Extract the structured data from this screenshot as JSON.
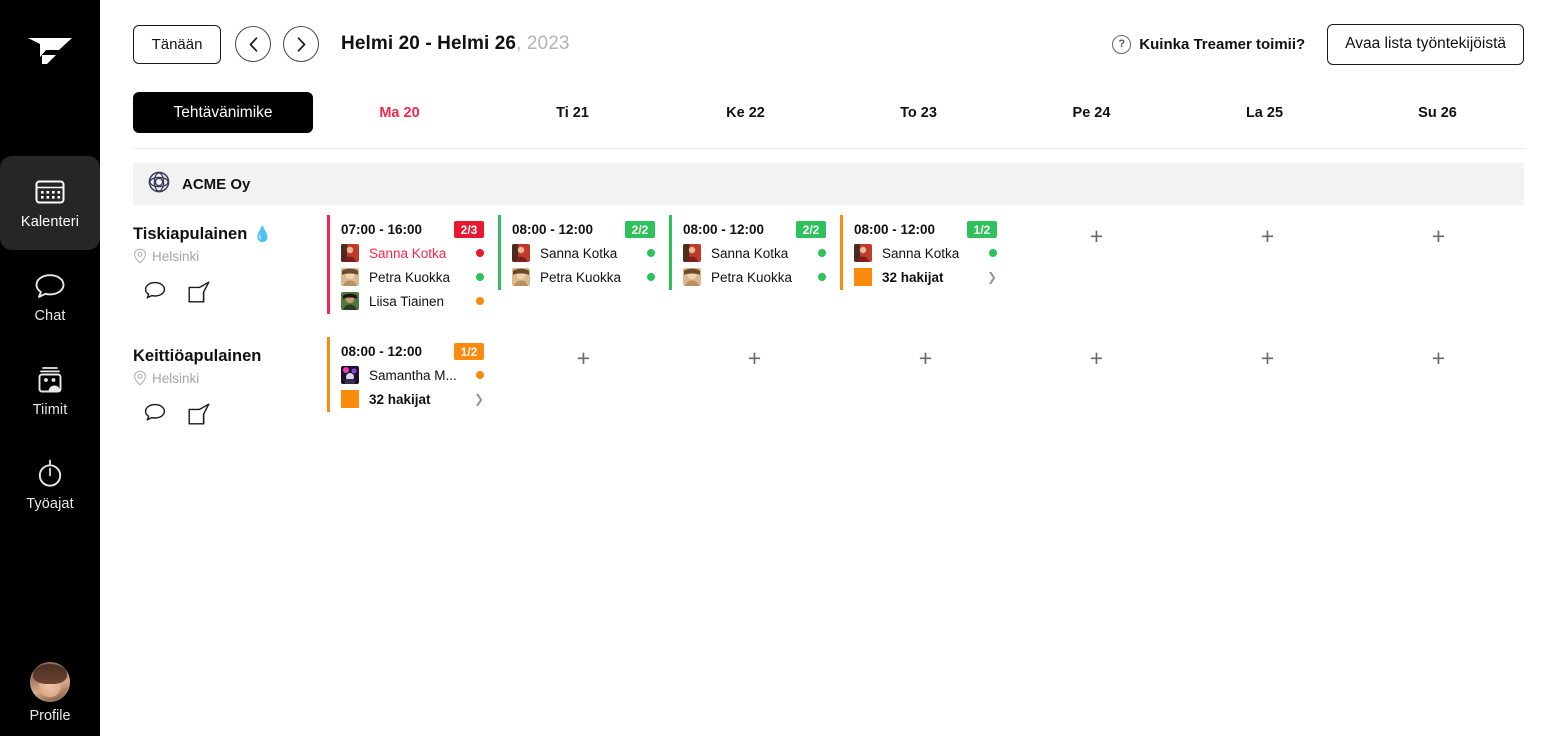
{
  "sidebar": {
    "logo_icon": "treamer-logo-icon",
    "items": [
      {
        "label": "Kalenteri",
        "icon": "calendar-icon",
        "active": true
      },
      {
        "label": "Chat",
        "icon": "chat-bubble-icon",
        "active": false
      },
      {
        "label": "Tiimit",
        "icon": "teams-icon",
        "active": false
      },
      {
        "label": "Työajat",
        "icon": "stopwatch-icon",
        "active": false
      }
    ],
    "profile": {
      "label": "Profile",
      "icon": "avatar-photo"
    }
  },
  "topbar": {
    "today_label": "Tänään",
    "prev_icon": "chevron-left-icon",
    "next_icon": "chevron-right-icon",
    "range_label": "Helmi 20 - Helmi 26",
    "range_separator": ", ",
    "year_label": "2023",
    "help_icon": "question-mark-icon",
    "help_label": "Kuinka Treamer toimii?",
    "open_list_label": "Avaa lista työntekijöistä"
  },
  "header_row": {
    "role_tab_label": "Tehtävänimike",
    "days": [
      {
        "label": "Ma 20",
        "today": true
      },
      {
        "label": "Ti 21",
        "today": false
      },
      {
        "label": "Ke 22",
        "today": false
      },
      {
        "label": "To 23",
        "today": false
      },
      {
        "label": "Pe 24",
        "today": false
      },
      {
        "label": "La 25",
        "today": false
      },
      {
        "label": "Su 26",
        "today": false
      }
    ]
  },
  "company": {
    "name": "ACME Oy",
    "logo_icon": "acme-company-logo-icon"
  },
  "colors": {
    "accent_red": "#f4274a",
    "green": "#2fc15c",
    "orange": "#fc8a0c",
    "black": "#000000",
    "band_gray": "#f2f2f2"
  },
  "location_icon": "map-pin-icon",
  "chat_icon": "chat-bubble-icon",
  "edit_icon": "edit-pencil-icon",
  "plus_icon": "plus-icon",
  "chevron_icon": "chevron-right-icon",
  "rows": [
    {
      "title": "Tiskiapulainen",
      "emoji": "💧",
      "location": "Helsinki",
      "cells": [
        {
          "type": "card",
          "bar_color": "#f4274a",
          "time": "07:00 - 16:00",
          "badge": "2/3",
          "badge_color": "#e8192f",
          "people": [
            {
              "name": "Sanna Kotka",
              "dot": "#e8192f",
              "name_color": "red",
              "avatar": "sanna"
            },
            {
              "name": "Petra Kuokka",
              "dot": "#2fc15c",
              "name_color": "black",
              "avatar": "petra"
            },
            {
              "name": "Liisa Tiainen",
              "dot": "#fc8a0c",
              "name_color": "black",
              "avatar": "liisa"
            }
          ]
        },
        {
          "type": "card",
          "bar_color": "#2fc15c",
          "time": "08:00 - 12:00",
          "badge": "2/2",
          "badge_color": "#2fc15c",
          "people": [
            {
              "name": "Sanna Kotka",
              "dot": "#2fc15c",
              "name_color": "black",
              "avatar": "sanna"
            },
            {
              "name": "Petra Kuokka",
              "dot": "#2fc15c",
              "name_color": "black",
              "avatar": "petra"
            }
          ]
        },
        {
          "type": "card",
          "bar_color": "#2fc15c",
          "time": "08:00 - 12:00",
          "badge": "2/2",
          "badge_color": "#2fc15c",
          "people": [
            {
              "name": "Sanna Kotka",
              "dot": "#2fc15c",
              "name_color": "black",
              "avatar": "sanna"
            },
            {
              "name": "Petra Kuokka",
              "dot": "#2fc15c",
              "name_color": "black",
              "avatar": "petra"
            }
          ]
        },
        {
          "type": "card",
          "bar_color": "#2fc15c",
          "time": "08:00 - 12:00",
          "badge": "1/2",
          "badge_color": "#2fc15c",
          "people": [
            {
              "name": "Sanna Kotka",
              "dot": "#2fc15c",
              "name_color": "black",
              "avatar": "sanna"
            },
            {
              "name": "32 hakijat",
              "chevron": true,
              "name_color": "bold",
              "avatar": "orange-swatch"
            }
          ]
        },
        {
          "type": "empty",
          "plus": "+"
        },
        {
          "type": "empty",
          "plus": "+"
        },
        {
          "type": "empty",
          "plus": "+"
        }
      ]
    },
    {
      "title": "Keittiöapulainen",
      "emoji": "",
      "location": "Helsinki",
      "cells": [
        {
          "type": "card",
          "bar_color": "#fc8a0c",
          "time": "08:00 - 12:00",
          "badge": "1/2",
          "badge_color": "#fc8a0c",
          "people": [
            {
              "name": "Samantha M...",
              "dot": "#fc8a0c",
              "name_color": "black",
              "avatar": "samantha"
            },
            {
              "name": "32 hakijat",
              "chevron": true,
              "name_color": "bold",
              "avatar": "orange-swatch"
            }
          ]
        },
        {
          "type": "empty",
          "plus": "+"
        },
        {
          "type": "empty",
          "plus": "+"
        },
        {
          "type": "empty",
          "plus": "+"
        },
        {
          "type": "empty",
          "plus": "+"
        },
        {
          "type": "empty",
          "plus": "+"
        },
        {
          "type": "empty",
          "plus": "+"
        }
      ]
    }
  ]
}
